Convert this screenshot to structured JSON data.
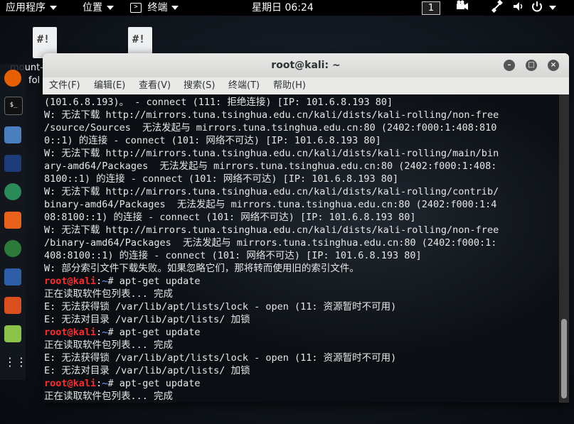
{
  "topbar": {
    "apps_menu": "应用程序",
    "places_menu": "位置",
    "terminal_menu": "终端",
    "clock": "星期日 06:24",
    "workspace": "1"
  },
  "desktop": {
    "icons": [
      {
        "label": "mount-",
        "label2": "fol"
      },
      {
        "label": ""
      }
    ]
  },
  "dock": {
    "items": [
      "firefox-icon",
      "terminal-icon",
      "files-icon",
      "metasploit-icon",
      "armitage-icon",
      "burpsuite-icon",
      "maltego-icon",
      "beef-icon",
      "faraday-icon",
      "notes-icon",
      "app-grid-icon"
    ]
  },
  "window": {
    "title": "root@kali: ~",
    "menu": [
      "文件(F)",
      "编辑(E)",
      "查看(V)",
      "搜索(S)",
      "终端(T)",
      "帮助(H)"
    ]
  },
  "terminal": {
    "prompt": {
      "user": "root@kali",
      "sep": ":",
      "path": "~",
      "symbol": "# "
    },
    "lines": [
      {
        "text": "(101.6.8.193)。 - connect (111: 拒绝连接) [IP: 101.6.8.193 80]"
      },
      {
        "text": "W: 无法下载 http://mirrors.tuna.tsinghua.edu.cn/kali/dists/kali-rolling/non-free"
      },
      {
        "text": "/source/Sources  无法发起与 mirrors.tuna.tsinghua.edu.cn:80 (2402:f000:1:408:810"
      },
      {
        "text": "0::1) 的连接 - connect (101: 网络不可达) [IP: 101.6.8.193 80]"
      },
      {
        "text": "W: 无法下载 http://mirrors.tuna.tsinghua.edu.cn/kali/dists/kali-rolling/main/bin"
      },
      {
        "text": "ary-amd64/Packages  无法发起与 mirrors.tuna.tsinghua.edu.cn:80 (2402:f000:1:408:"
      },
      {
        "text": "8100::1) 的连接 - connect (101: 网络不可达) [IP: 101.6.8.193 80]"
      },
      {
        "text": "W: 无法下载 http://mirrors.tuna.tsinghua.edu.cn/kali/dists/kali-rolling/contrib/"
      },
      {
        "text": "binary-amd64/Packages  无法发起与 mirrors.tuna.tsinghua.edu.cn:80 (2402:f000:1:4"
      },
      {
        "text": "08:8100::1) 的连接 - connect (101: 网络不可达) [IP: 101.6.8.193 80]"
      },
      {
        "text": "W: 无法下载 http://mirrors.tuna.tsinghua.edu.cn/kali/dists/kali-rolling/non-free"
      },
      {
        "text": "/binary-amd64/Packages  无法发起与 mirrors.tuna.tsinghua.edu.cn:80 (2402:f000:1:"
      },
      {
        "text": "408:8100::1) 的连接 - connect (101: 网络不可达) [IP: 101.6.8.193 80]"
      },
      {
        "text": "W: 部分索引文件下载失败。如果忽略它们，那将转而使用旧的索引文件。"
      },
      {
        "prompt": true,
        "text": "apt-get update"
      },
      {
        "text": "正在读取软件包列表... 完成"
      },
      {
        "text": "E: 无法获得锁 /var/lib/apt/lists/lock - open (11: 资源暂时不可用)"
      },
      {
        "text": "E: 无法对目录 /var/lib/apt/lists/ 加锁"
      },
      {
        "prompt": true,
        "text": "apt-get update"
      },
      {
        "text": "正在读取软件包列表... 完成"
      },
      {
        "text": "E: 无法获得锁 /var/lib/apt/lists/lock - open (11: 资源暂时不可用)"
      },
      {
        "text": "E: 无法对目录 /var/lib/apt/lists/ 加锁"
      },
      {
        "prompt": true,
        "text": "apt-get update"
      },
      {
        "text": "正在读取软件包列表... 完成"
      }
    ]
  },
  "colors": {
    "prompt_user": "#ff2a2a",
    "prompt_path": "#5fa8ff",
    "terminal_bg": "#0b0f14",
    "text": "#e6e6e6"
  }
}
